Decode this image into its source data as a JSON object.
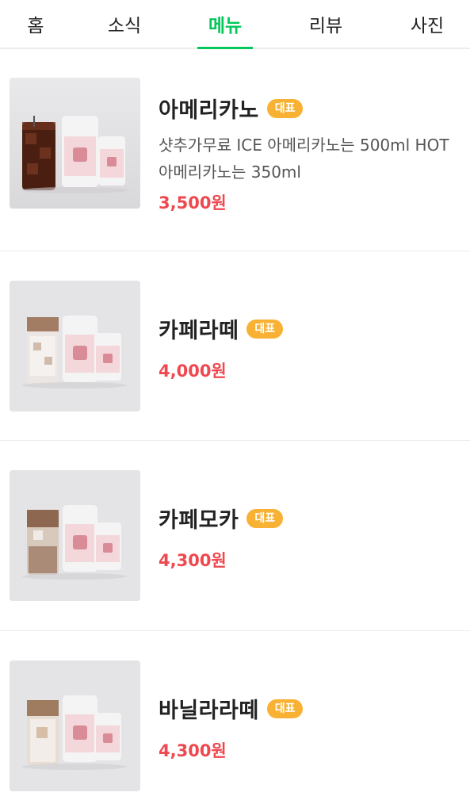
{
  "tabs": [
    {
      "label": "홈"
    },
    {
      "label": "소식"
    },
    {
      "label": "메뉴"
    },
    {
      "label": "리뷰"
    },
    {
      "label": "사진"
    }
  ],
  "active_tab": "메뉴",
  "colors": {
    "accent": "#03c75a",
    "badge": "#f8b133",
    "price": "#f0484f"
  },
  "menu_items": [
    {
      "name": "아메리카노",
      "badge": "대표",
      "description": "샷추가무료 ICE 아메리카노는 500ml HOT 아메리카노는 350ml",
      "price": "3,500원"
    },
    {
      "name": "카페라떼",
      "badge": "대표",
      "price": "4,000원"
    },
    {
      "name": "카페모카",
      "badge": "대표",
      "price": "4,300원"
    },
    {
      "name": "바닐라라떼",
      "badge": "대표",
      "price": "4,300원"
    }
  ]
}
